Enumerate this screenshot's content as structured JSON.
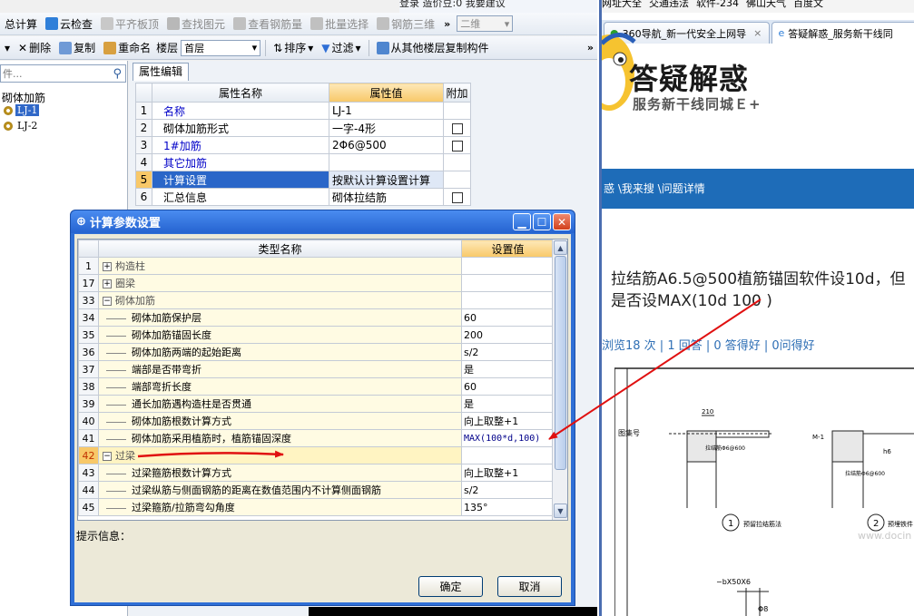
{
  "app": {
    "topstrip": "登录  造价豆:0  我要建议",
    "toolbar1": {
      "calc_total": "总计算",
      "cloud_check": "云检查",
      "flatten_slab": "平齐板顶",
      "find_element": "查找图元",
      "view_rebar": "查看钢筋量",
      "batch_select": "批量选择",
      "rebar_3d": "钢筋三维",
      "view_mode": "二维",
      "more": "»"
    },
    "toolbar2": {
      "delete": "删除",
      "copy": "复制",
      "rename": "重命名",
      "floor_label": "楼层",
      "floor_value": "首层",
      "sort": "排序",
      "filter": "过滤",
      "copy_from_floor": "从其他楼层复制构件",
      "more": "»"
    },
    "left": {
      "search_placeholder": "件...",
      "tree_root": "砌体加筋",
      "items": [
        "LJ-1",
        "LJ-2"
      ]
    },
    "props": {
      "tab": "属性编辑",
      "headers": {
        "name": "属性名称",
        "value": "属性值",
        "extra": "附加"
      },
      "rows": [
        {
          "num": "1",
          "name": "名称",
          "value": "LJ-1"
        },
        {
          "num": "2",
          "name": "砌体加筋形式",
          "value": "一字-4形"
        },
        {
          "num": "3",
          "name": "1#加筋",
          "value": "2Φ6@500"
        },
        {
          "num": "4",
          "name": "其它加筋",
          "value": ""
        },
        {
          "num": "5",
          "name": "计算设置",
          "value": "按默认计算设置计算"
        },
        {
          "num": "6",
          "name": "汇总信息",
          "value": "砌体拉结筋"
        }
      ]
    }
  },
  "dialog": {
    "title": "计算参数设置",
    "headers": {
      "type": "类型名称",
      "value": "设置值"
    },
    "rows": [
      {
        "num": "1",
        "kind": "group",
        "toggle": "+",
        "label": "构造柱",
        "value": ""
      },
      {
        "num": "17",
        "kind": "group",
        "toggle": "+",
        "label": "圈梁",
        "value": ""
      },
      {
        "num": "33",
        "kind": "group",
        "toggle": "−",
        "label": "砌体加筋",
        "value": ""
      },
      {
        "num": "34",
        "kind": "item",
        "label": "砌体加筋保护层",
        "value": "60"
      },
      {
        "num": "35",
        "kind": "item",
        "label": "砌体加筋锚固长度",
        "value": "200"
      },
      {
        "num": "36",
        "kind": "item",
        "label": "砌体加筋两端的起始距离",
        "value": "s/2"
      },
      {
        "num": "37",
        "kind": "item",
        "label": "端部是否带弯折",
        "value": "是"
      },
      {
        "num": "38",
        "kind": "item",
        "label": "端部弯折长度",
        "value": "60"
      },
      {
        "num": "39",
        "kind": "item",
        "label": "通长加筋遇构造柱是否贯通",
        "value": "是"
      },
      {
        "num": "40",
        "kind": "item",
        "label": "砌体加筋根数计算方式",
        "value": "向上取整+1"
      },
      {
        "num": "41",
        "kind": "item",
        "label": "砌体加筋采用植筋时，植筋锚固深度",
        "value": "MAX(100*d,100)"
      },
      {
        "num": "42",
        "kind": "group",
        "toggle": "−",
        "label": "过梁",
        "value": ""
      },
      {
        "num": "43",
        "kind": "item",
        "label": "过梁箍筋根数计算方式",
        "value": "向上取整+1"
      },
      {
        "num": "44",
        "kind": "item",
        "label": "过梁纵筋与侧面钢筋的距离在数值范围内不计算侧面钢筋",
        "value": "s/2"
      },
      {
        "num": "45",
        "kind": "item",
        "label": "过梁箍筋/拉筋弯勾角度",
        "value": "135°"
      }
    ],
    "hint_label": "提示信息：",
    "ok": "确定",
    "cancel": "取消"
  },
  "browser": {
    "bookmarks": [
      "网址大全",
      "交通违法",
      "软件-234",
      "佛山天气",
      "百度文"
    ],
    "tabs": [
      {
        "label": "360导航_新一代安全上网导"
      },
      {
        "label": "答疑解惑_服务新干线同"
      }
    ],
    "logo_title": "答疑解惑",
    "logo_sub": "服务新干线同城Ｅ+",
    "breadcrumb": "惑 \\我来搜 \\问题详情",
    "question": "拉结筋A6.5@500植筋锚固软件设10d，但是否设MAX(10d 100 )",
    "stats": "浏览18 次 | 1 回答 | 0 答得好 | 0问得好",
    "drawing_labels": {
      "dim_top": "210",
      "note1": "拉结筋Φ6@600",
      "note2": "拉结筋Φ6@600",
      "label1": "预留拉结筋法",
      "label2": "预埋铁件",
      "circle1": "1",
      "circle2": "2",
      "m1": "M-1",
      "h6": "h6",
      "bottom": "−bX50X6",
      "phi8": "Φ8",
      "side": "图集号"
    },
    "watermark": "www.docin"
  }
}
